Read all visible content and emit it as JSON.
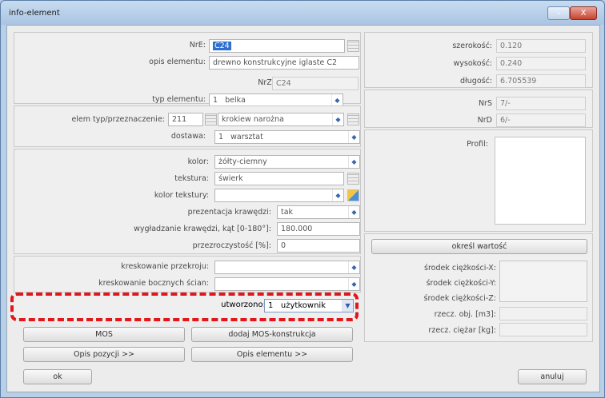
{
  "window": {
    "title": "info-element",
    "min_glyph": "–",
    "close_glyph": "X"
  },
  "basic": {
    "nre_label": "NrE:",
    "nre_value": "C24",
    "opis_label": "opis elementu:",
    "opis_value": "drewno konstrukcyjne iglaste C2",
    "nrz_label": "NrZ:",
    "nrz_value": "C24",
    "typ_label": "typ elementu:",
    "typ_num": "1",
    "typ_value": "belka"
  },
  "usage": {
    "elem_label": "elem typ/przeznaczenie:",
    "elem_num": "211",
    "elem_value": "krokiew narożna",
    "dostawa_label": "dostawa:",
    "dostawa_num": "1",
    "dostawa_value": "warsztat"
  },
  "appearance": {
    "kolor_label": "kolor:",
    "kolor_value": "żółty-ciemny",
    "tekstura_label": "tekstura:",
    "tekstura_value": "świerk",
    "kolor_tekstury_label": "kolor tekstury:",
    "kolor_tekstury_value": "",
    "prezentacja_label": "prezentacja krawędzi:",
    "prezentacja_value": "tak",
    "wygladzanie_label": "wygładzanie krawędzi, kąt [0-180°]:",
    "wygladzanie_value": "180.000",
    "przezroczystosc_label": "przezroczystość [%]:",
    "przezroczystosc_value": "0"
  },
  "hatching": {
    "przekroj_label": "kreskowanie przekroju:",
    "przekroj_value": "",
    "boczne_label": "kreskowanie bocznych ścian:",
    "boczne_value": ""
  },
  "created": {
    "label": "utworzono:",
    "num": "1",
    "value": "użytkownik"
  },
  "dimensions": {
    "szerokosc_label": "szerokość:",
    "szerokosc_value": "0.120",
    "wysokosc_label": "wysokość:",
    "wysokosc_value": "0.240",
    "dlugosc_label": "długość:",
    "dlugosc_value": "6.705539"
  },
  "numbers": {
    "nrs_label": "NrS",
    "nrs_value": "7/-",
    "nrd_label": "NrD",
    "nrd_value": "6/-"
  },
  "profile": {
    "label": "Profil:"
  },
  "compute": {
    "button": "określ wartość",
    "cx_label": "środek ciężkości-X:",
    "cy_label": "środek ciężkości-Y:",
    "cz_label": "środek ciężkości-Z:",
    "vol_label": "rzecz. obj. [m3]:",
    "weight_label": "rzecz. ciężar [kg]:"
  },
  "buttons": {
    "mos": "MOS",
    "add_mos": "dodaj MOS-konstrukcja",
    "opis_pozycji": "Opis pozycji >>",
    "opis_elementu": "Opis elementu >>",
    "ok": "ok",
    "cancel": "anuluj"
  },
  "colors": {
    "highlight_border": "#e0171b",
    "selection": "#2f6fd0"
  }
}
